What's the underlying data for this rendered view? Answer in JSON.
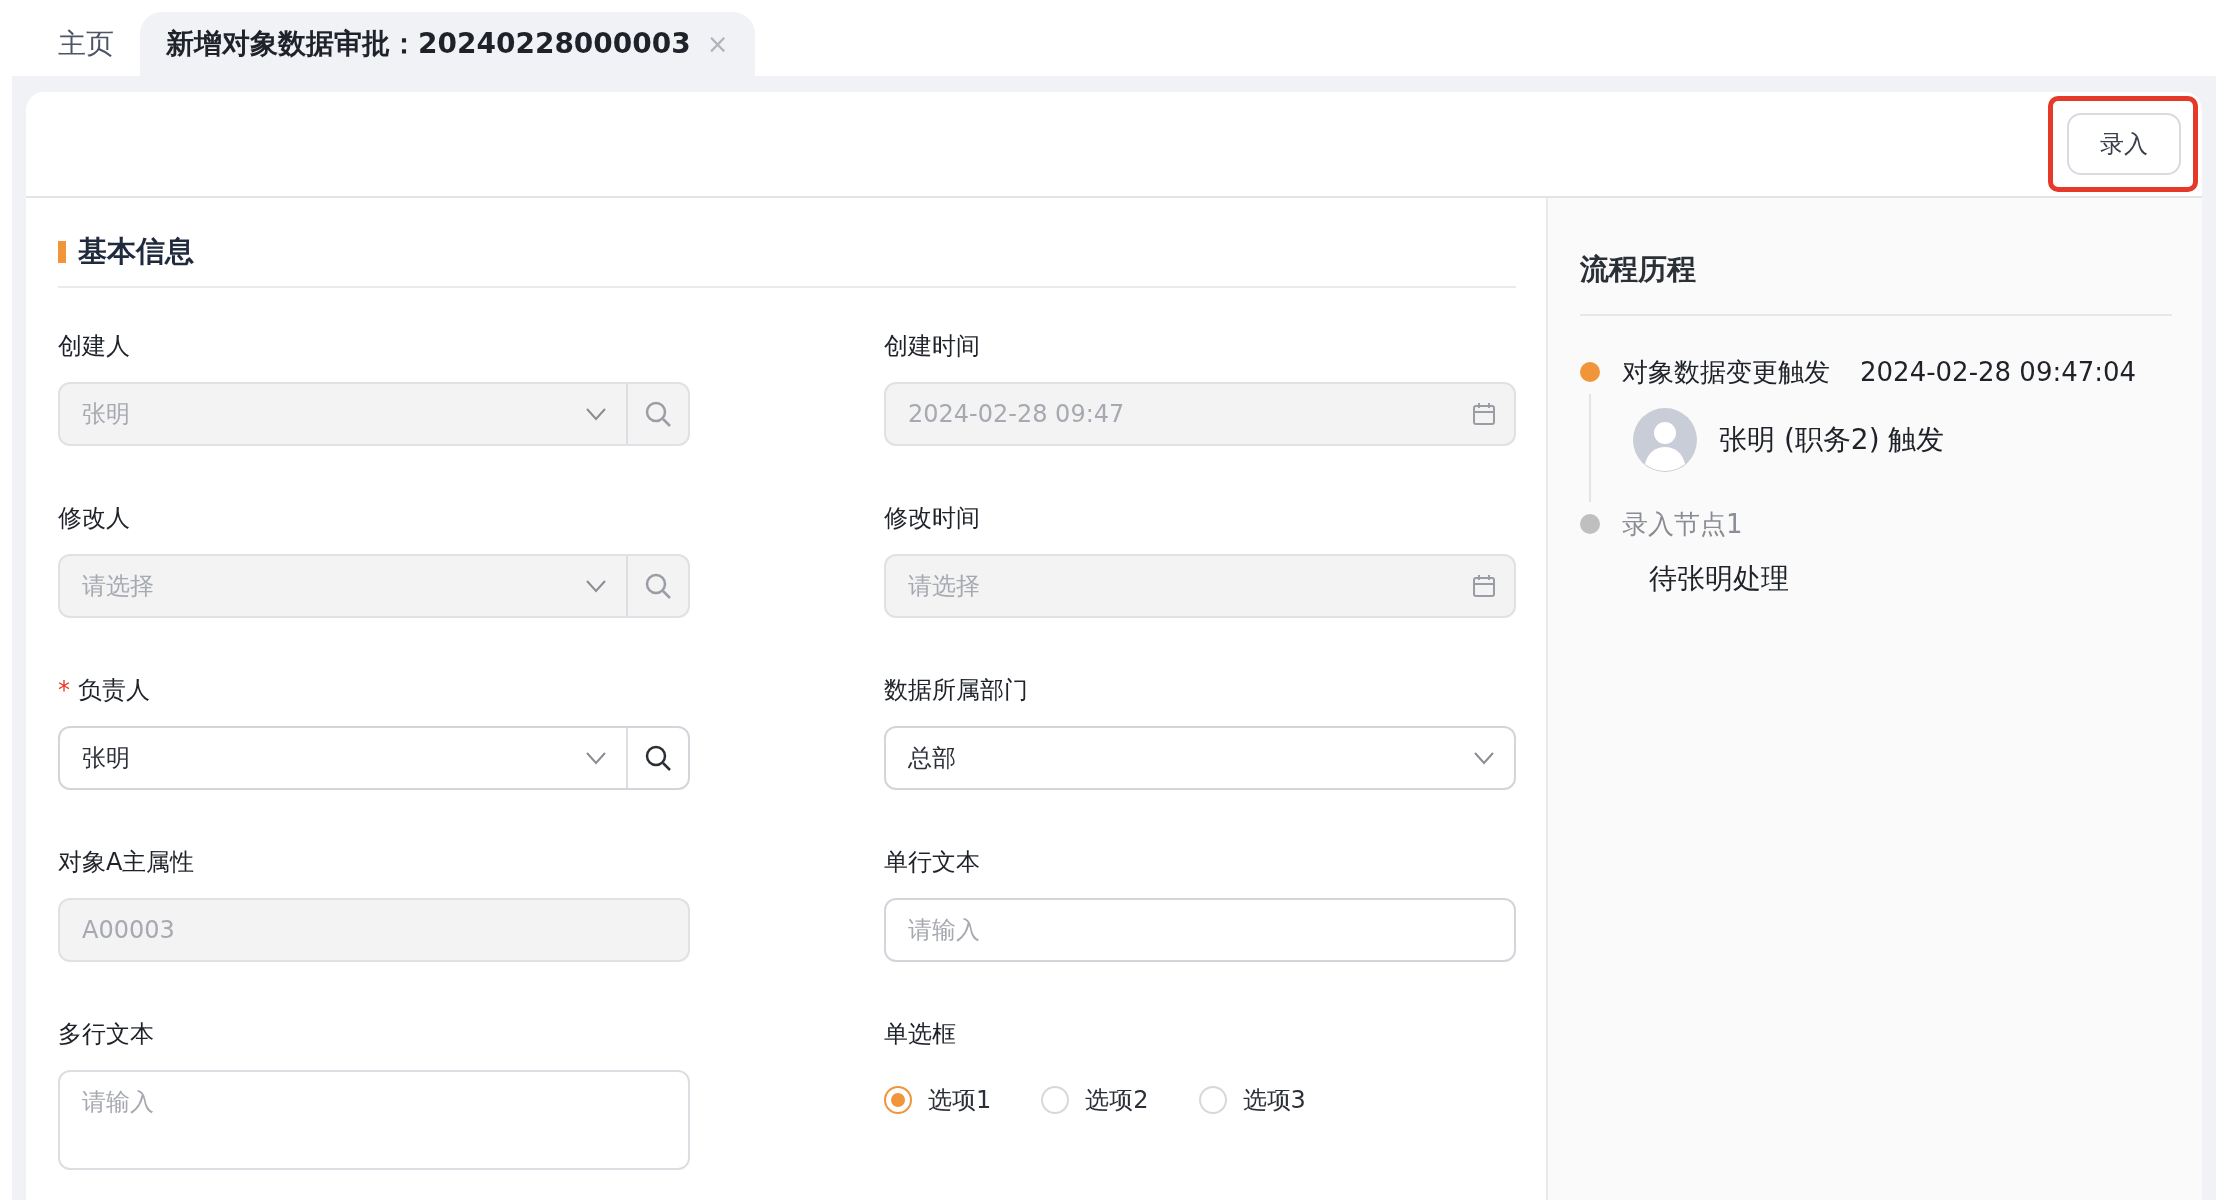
{
  "tabs": [
    {
      "label": "主页",
      "selected": false
    },
    {
      "label": "新增对象数据审批：20240228000003",
      "selected": true,
      "close": "×"
    }
  ],
  "required_mark": "*",
  "toolbar": {
    "button": "录入",
    "highlighted": true
  },
  "section": {
    "title": "基本信息"
  },
  "fields": [
    {
      "kind": "select-search",
      "label": "创建人",
      "required": false,
      "value": "张明",
      "disabled": true
    },
    {
      "kind": "date",
      "label": "创建时间",
      "required": false,
      "value": "2024-02-28 09:47",
      "disabled": true
    },
    {
      "kind": "select-search",
      "label": "修改人",
      "required": false,
      "placeholder": "请选择",
      "disabled": true
    },
    {
      "kind": "date",
      "label": "修改时间",
      "required": false,
      "placeholder": "请选择",
      "disabled": true
    },
    {
      "kind": "select-search",
      "label": "负责人",
      "required": true,
      "value": "张明",
      "disabled": false
    },
    {
      "kind": "select",
      "label": "数据所属部门",
      "required": false,
      "value": "总部",
      "disabled": false
    },
    {
      "kind": "text",
      "label": "对象A主属性",
      "required": false,
      "value": "A00003",
      "disabled": true
    },
    {
      "kind": "text",
      "label": "单行文本",
      "required": false,
      "placeholder": "请输入",
      "disabled": false
    },
    {
      "kind": "textarea",
      "label": "多行文本",
      "required": false,
      "placeholder": "请输入"
    },
    {
      "kind": "radio",
      "label": "单选框",
      "required": false,
      "options": [
        {
          "label": "选项1",
          "selected": true
        },
        {
          "label": "选项2",
          "selected": false
        },
        {
          "label": "选项3",
          "selected": false
        }
      ]
    }
  ],
  "history": {
    "title": "流程历程",
    "steps": [
      {
        "title": "对象数据变更触发",
        "time": "2024-02-28 09:47:04",
        "color": "#f0953a",
        "active": true,
        "person": "张明 (职务2) 触发"
      },
      {
        "title": "录入节点1",
        "color": "#bfbfbf",
        "active": false,
        "note": "待张明处理"
      }
    ]
  }
}
